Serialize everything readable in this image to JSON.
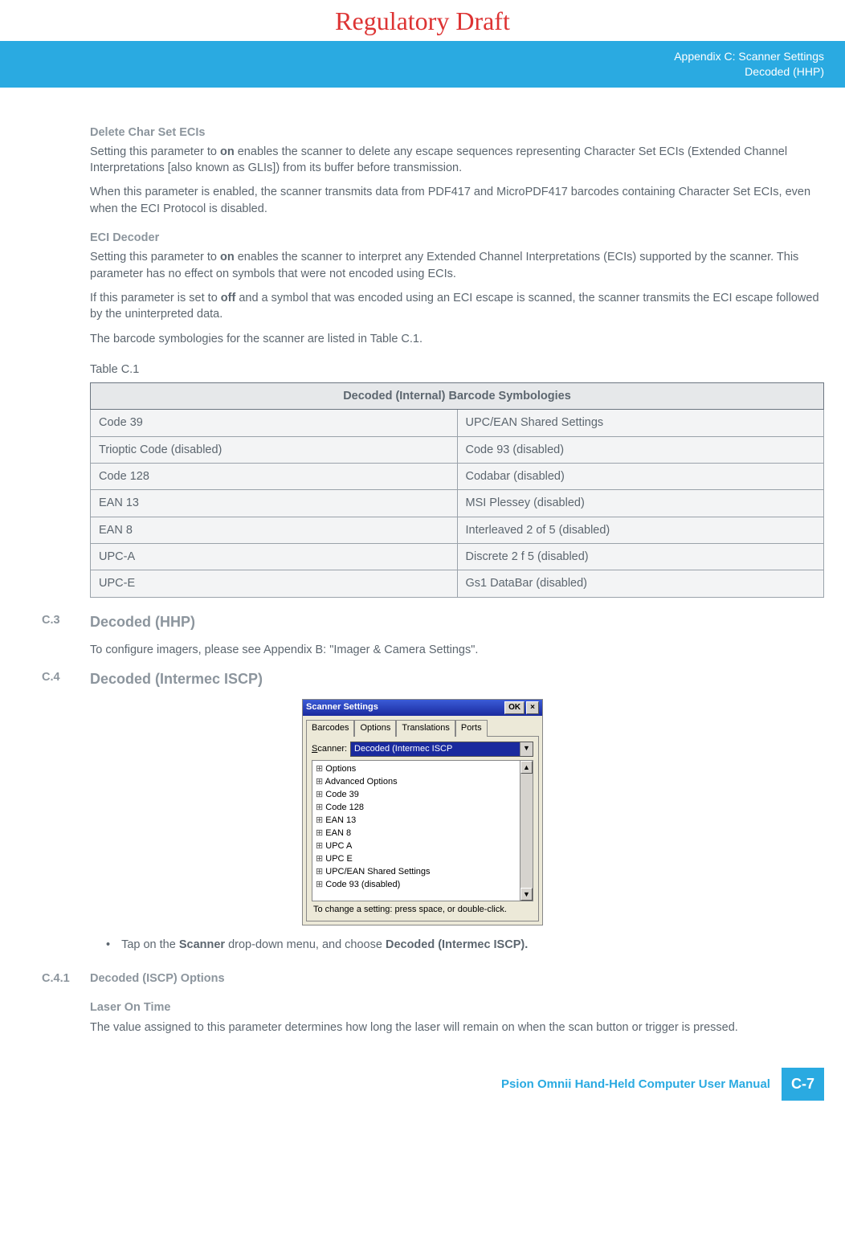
{
  "draft": "Regulatory Draft",
  "header": {
    "line1": "Appendix C: Scanner Settings",
    "line2": "Decoded (HHP)"
  },
  "s1": {
    "h": "Delete Char Set ECIs",
    "p1a": "Setting this parameter to ",
    "p1b": "on",
    "p1c": " enables the scanner to delete any escape sequences representing Character Set ECIs (Extended Channel Interpretations [also known as GLIs]) from its buffer before transmission.",
    "p2": "When this parameter is enabled, the scanner transmits data from PDF417 and MicroPDF417 barcodes containing Character Set ECIs, even when the ECI Protocol is disabled."
  },
  "s2": {
    "h": "ECI Decoder",
    "p1a": "Setting this parameter to ",
    "p1b": "on",
    "p1c": " enables the scanner to interpret any Extended Channel Interpretations (ECIs) supported by the scanner. This parameter has no effect on symbols that were not encoded using ECIs.",
    "p2a": "If this parameter is set to ",
    "p2b": "off",
    "p2c": " and a symbol that was encoded using an ECI escape is scanned, the scanner transmits the ECI escape followed by the uninterpreted data.",
    "p3": "The barcode symbologies for the scanner are listed in Table C.1."
  },
  "table": {
    "caption": "Table C.1",
    "header": "Decoded (Internal) Barcode Symbologies",
    "rows": [
      [
        "Code 39",
        "UPC/EAN Shared Settings"
      ],
      [
        "Trioptic Code (disabled)",
        "Code 93 (disabled)"
      ],
      [
        "Code 128",
        "Codabar (disabled)"
      ],
      [
        "EAN 13",
        "MSI Plessey (disabled)"
      ],
      [
        "EAN 8",
        "Interleaved 2 of 5 (disabled)"
      ],
      [
        "UPC-A",
        "Discrete 2 f 5 (disabled)"
      ],
      [
        "UPC-E",
        "Gs1 DataBar (disabled)"
      ]
    ]
  },
  "c3": {
    "num": "C.3",
    "title": "Decoded (HHP)",
    "p": "To configure imagers, please see Appendix B: \"Imager & Camera Settings\"."
  },
  "c4": {
    "num": "C.4",
    "title": "Decoded (Intermec ISCP)"
  },
  "shot": {
    "title": "Scanner Settings",
    "ok": "OK",
    "close": "×",
    "tabs": [
      "Barcodes",
      "Options",
      "Translations",
      "Ports"
    ],
    "scanner_label": "Scanner:",
    "scanner_value": "Decoded (Intermec ISCP",
    "tree": [
      "Options",
      "Advanced Options",
      "Code 39",
      "Code 128",
      "EAN 13",
      "EAN 8",
      "UPC A",
      "UPC E",
      "UPC/EAN Shared Settings",
      "Code 93 (disabled)"
    ],
    "hint": "To change a setting: press space, or double-click."
  },
  "bullet_a": "Tap on the ",
  "bullet_b": "Scanner",
  "bullet_c": " drop-down menu, and choose ",
  "bullet_d": "Decoded (Intermec ISCP).",
  "c41": {
    "num": "C.4.1",
    "title": "Decoded (ISCP) Options"
  },
  "laser": {
    "h": "Laser On Time",
    "p": "The value assigned to this parameter determines how long the laser will remain on when the scan button or trigger is pressed."
  },
  "footer": {
    "title": "Psion Omnii Hand-Held Computer User Manual",
    "page": "C-7"
  }
}
